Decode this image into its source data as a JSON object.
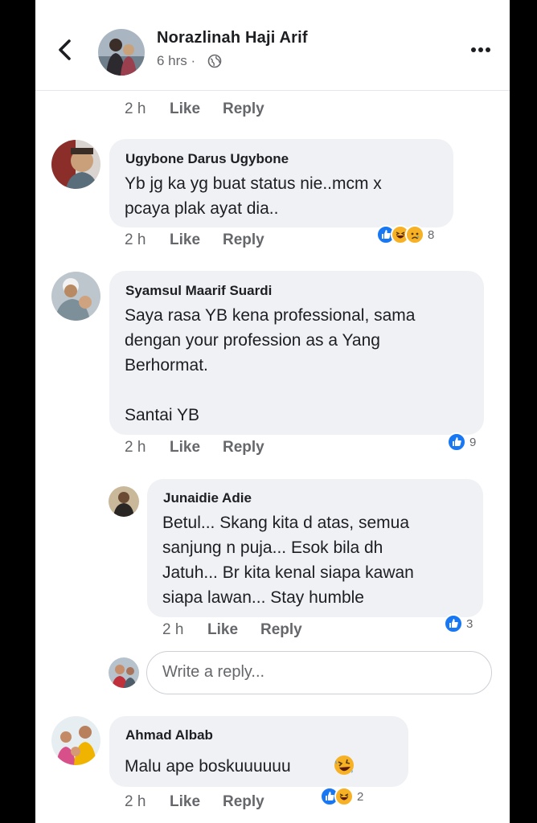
{
  "header": {
    "name": "Norazlinah Haji Arif",
    "time": "6 hrs ·"
  },
  "top_meta": {
    "time": "2 h",
    "like": "Like",
    "reply": "Reply"
  },
  "comments": [
    {
      "name": "Ugybone Darus Ugybone",
      "lines": [
        "Yb jg ka yg buat status nie..mcm x",
        "pcaya plak ayat dia.."
      ],
      "time": "2 h",
      "like": "Like",
      "reply": "Reply",
      "reaction_count": "8",
      "reactions": [
        "like",
        "haha",
        "sad"
      ]
    },
    {
      "name": "Syamsul Maarif Suardi",
      "lines": [
        "Saya rasa YB kena professional, sama",
        "dengan your profession as a Yang",
        "Berhormat.",
        "",
        "Santai YB"
      ],
      "time": "2 h",
      "like": "Like",
      "reply": "Reply",
      "reaction_count": "9",
      "reactions": [
        "like"
      ]
    },
    {
      "name": "Junaidie Adie",
      "lines": [
        "Betul... Skang kita d atas, semua",
        "sanjung n puja... Esok bila dh",
        "Jatuh... Br kita kenal siapa kawan",
        "siapa lawan... Stay humble"
      ],
      "time": "2 h",
      "like": "Like",
      "reply": "Reply",
      "reaction_count": "3",
      "reactions": [
        "like"
      ]
    },
    {
      "name": "Ahmad Albab",
      "lines": [
        "Malu ape boskuuuuuu"
      ],
      "time": "2 h",
      "like": "Like",
      "reply": "Reply",
      "reaction_count": "2",
      "reactions": [
        "like",
        "haha"
      ]
    }
  ],
  "write_reply": {
    "placeholder": "Write a reply..."
  },
  "colors": {
    "like_blue": "#1877f2",
    "bubble": "#eff1f4",
    "meta": "#65676b",
    "emoji_yellow": "#f7b125"
  }
}
